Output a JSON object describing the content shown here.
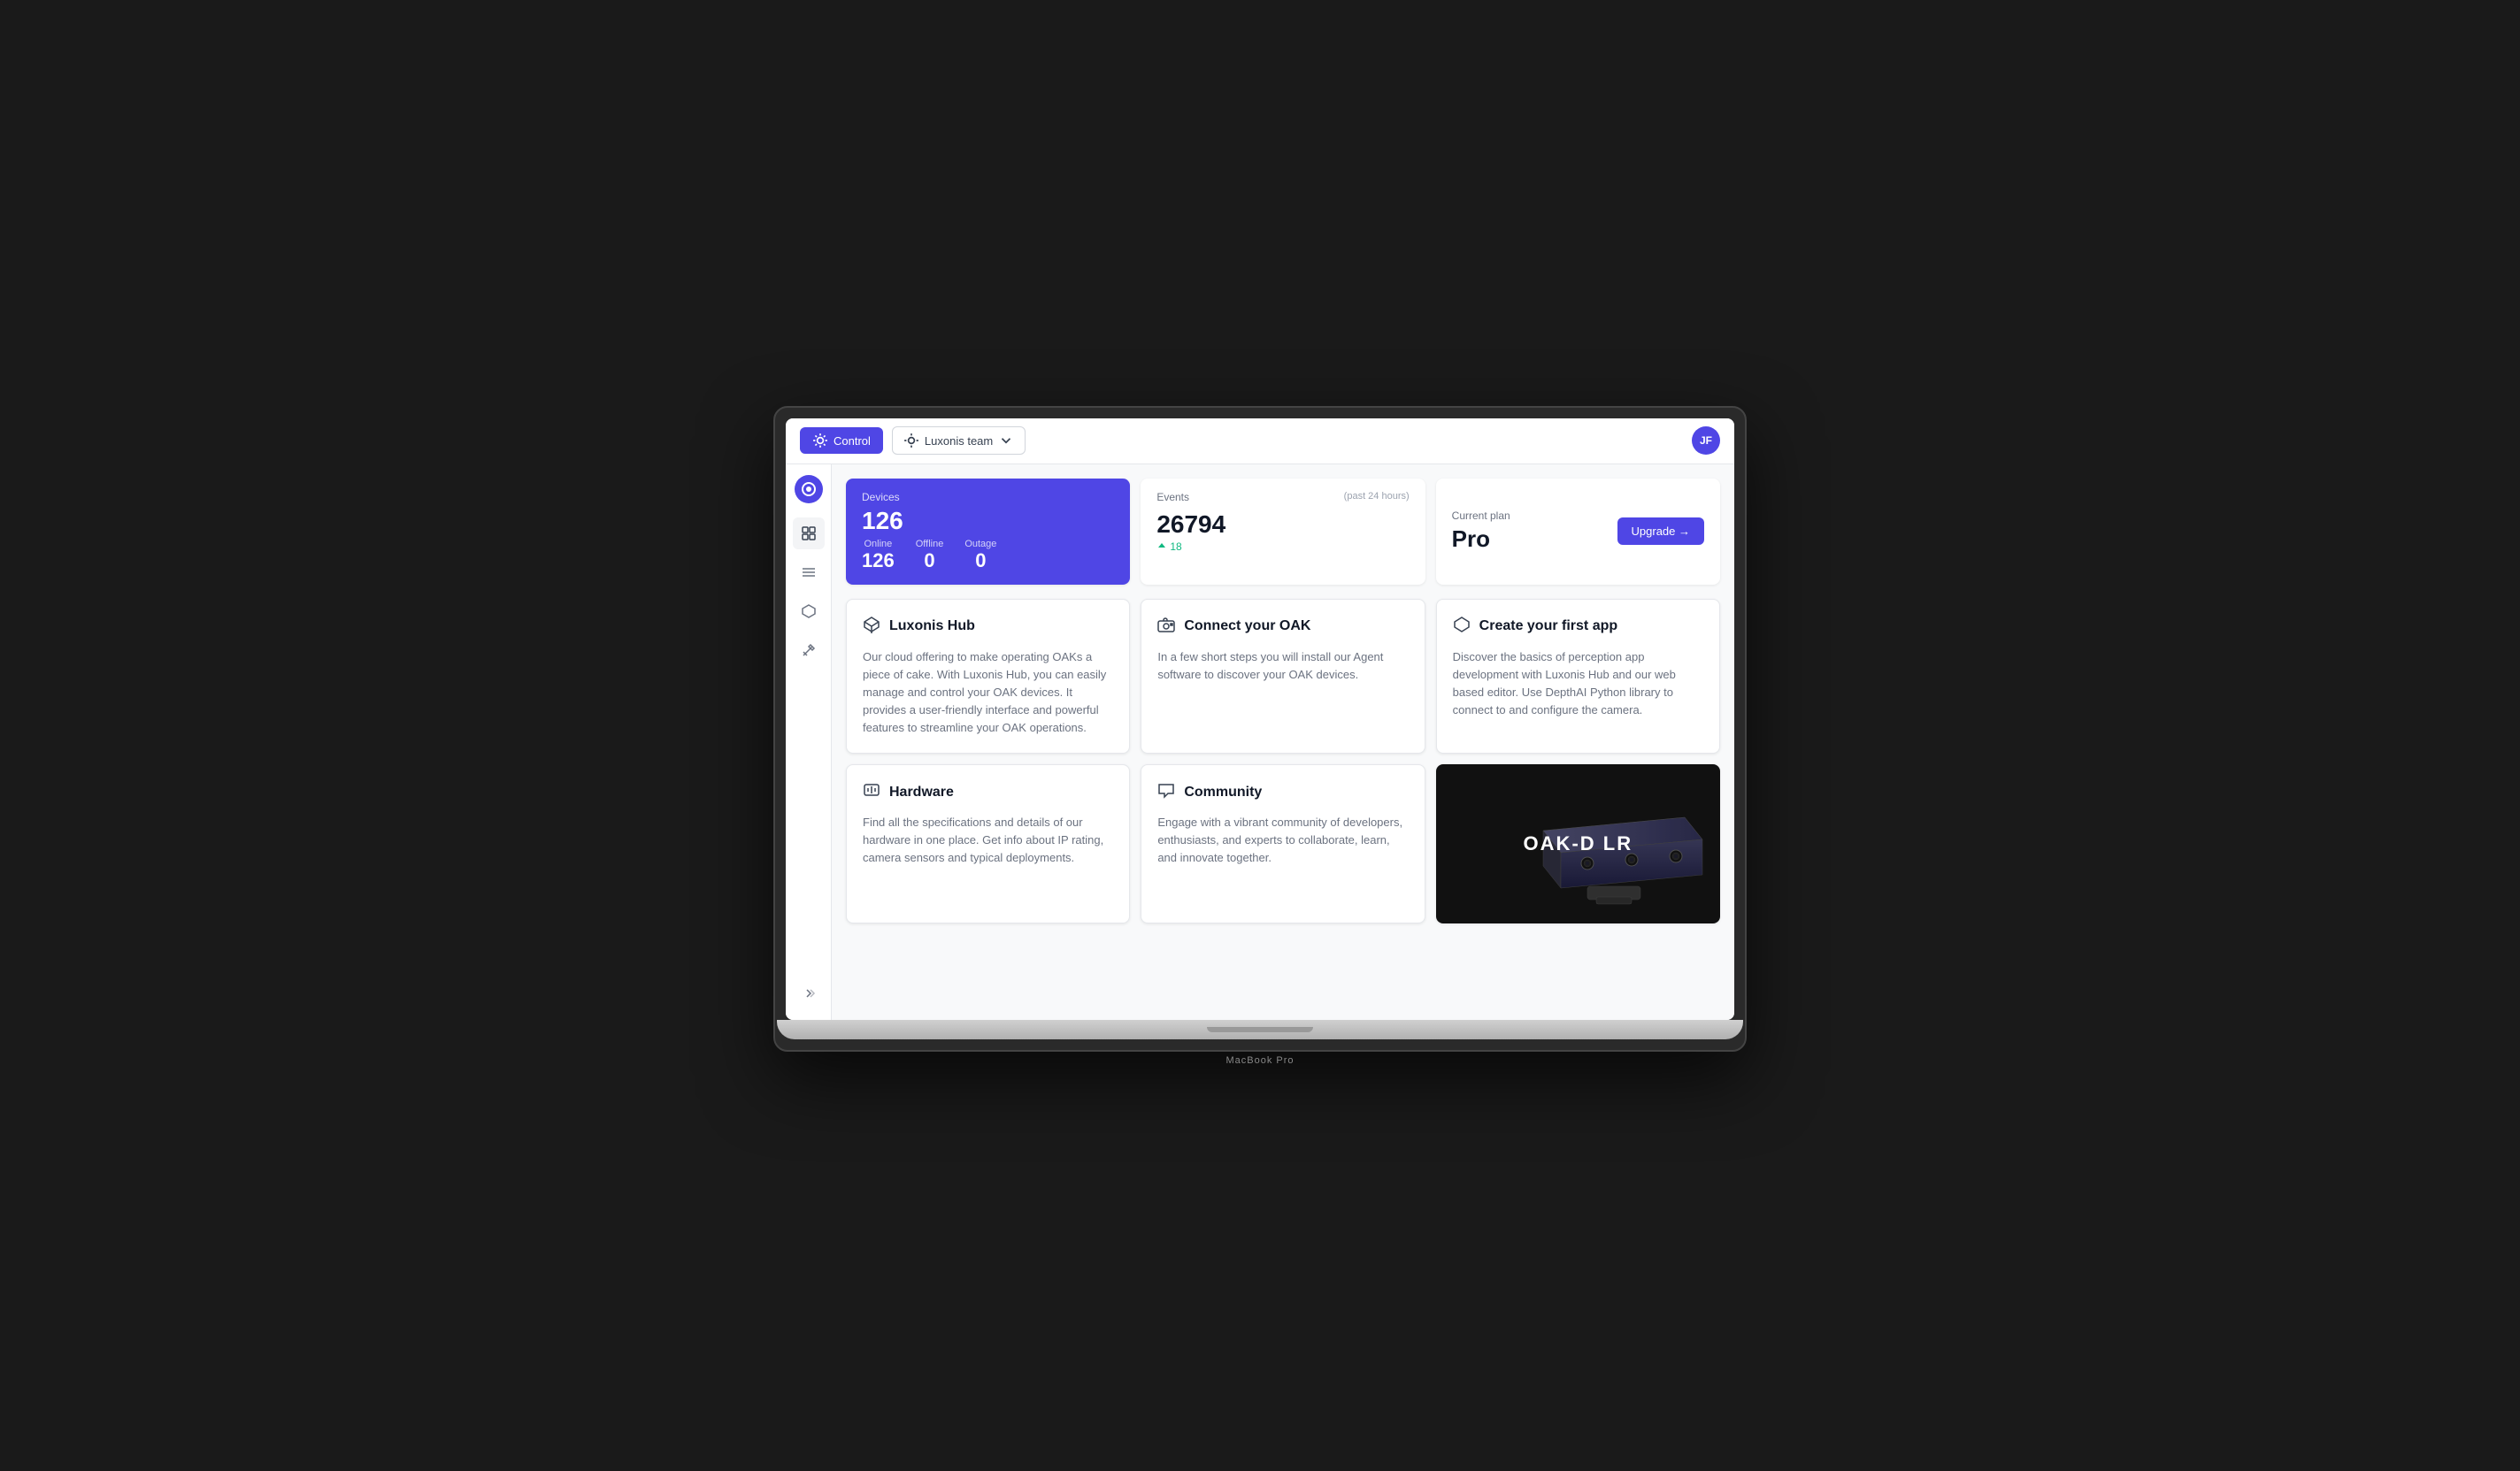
{
  "app": {
    "title": "Luxonis Hub",
    "macbook_label": "MacBook Pro"
  },
  "topbar": {
    "control_label": "Control",
    "team_label": "Luxonis team",
    "avatar_initials": "JF"
  },
  "sidebar": {
    "logo_icon": "target-icon",
    "items": [
      {
        "name": "grid-icon",
        "label": "Dashboard",
        "active": true
      },
      {
        "name": "menu-icon",
        "label": "Devices",
        "active": false
      },
      {
        "name": "cube-icon",
        "label": "Apps",
        "active": false
      },
      {
        "name": "scissors-icon",
        "label": "Tools",
        "active": false
      }
    ],
    "expand_icon": "chevrons-right-icon"
  },
  "stats": {
    "devices": {
      "label": "Devices",
      "total": "126",
      "online_label": "Online",
      "online": "126",
      "offline_label": "Offline",
      "offline": "0",
      "outage_label": "Outage",
      "outage": "0"
    },
    "events": {
      "label": "Events",
      "period": "(past 24 hours)",
      "count": "26794",
      "change": "18",
      "change_direction": "up"
    },
    "plan": {
      "label": "Current plan",
      "name": "Pro",
      "upgrade_label": "Upgrade →"
    }
  },
  "cards": [
    {
      "id": "luxonis-hub",
      "icon": "⬡",
      "title": "Luxonis Hub",
      "description": "Our cloud offering to make operating OAKs a piece of cake. With Luxonis Hub, you can easily manage and control your OAK devices. It provides a user-friendly interface and powerful features to streamline your OAK operations."
    },
    {
      "id": "connect-oak",
      "icon": "📷",
      "title": "Connect your OAK",
      "description": "In a few short steps you will install our Agent software to discover your OAK devices."
    },
    {
      "id": "create-app",
      "icon": "⬡",
      "title": "Create your first app",
      "description": "Discover the basics of perception app development with Luxonis Hub and our web based editor. Use DepthAI Python library to connect to and configure the camera."
    },
    {
      "id": "hardware",
      "icon": "🔲",
      "title": "Hardware",
      "description": "Find all the specifications and details of our hardware in one place. Get info about IP rating, camera sensors and typical deployments."
    },
    {
      "id": "community",
      "icon": "💬",
      "title": "Community",
      "description": "Engage with a vibrant community of developers, enthusiasts, and experts to collaborate, learn, and innovate together."
    },
    {
      "id": "oak-device",
      "label": "OAK-D LR",
      "type": "image"
    }
  ]
}
